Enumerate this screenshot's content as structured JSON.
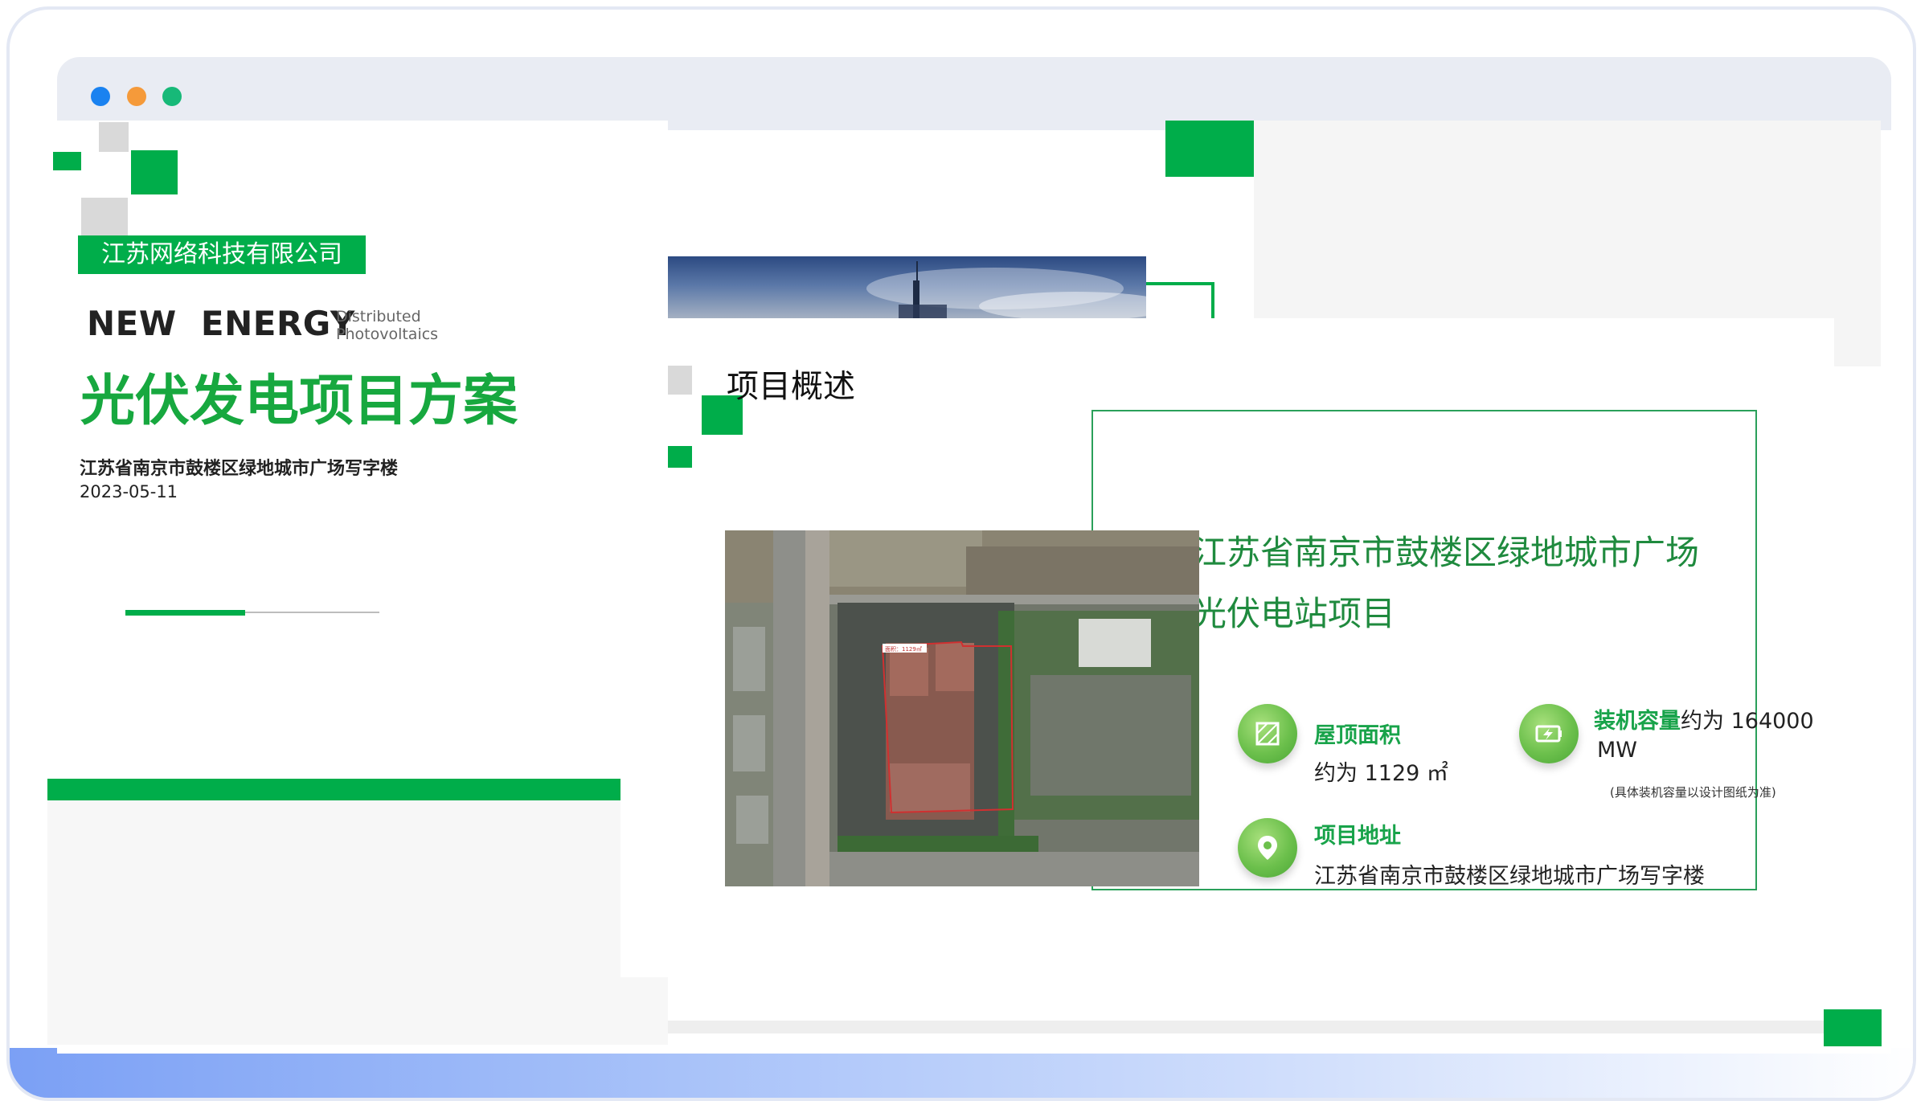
{
  "window": {
    "controls": [
      "close",
      "minimize",
      "maximize"
    ]
  },
  "slide_cover": {
    "company": "江苏网络科技有限公司",
    "tagline": "NEW  ENERGY",
    "subtitle_line1": "Distributed",
    "subtitle_line2": "Photovoltaics",
    "title": "光伏发电项目方案",
    "address": "江苏省南京市鼓楼区绿地城市广场写字楼",
    "date": "2023-05-11",
    "progress": 0.47
  },
  "slide_overview": {
    "section_title": "项目概述",
    "project_title_line1": "江苏省南京市鼓楼区绿地城市广场",
    "project_title_line2": "光伏电站项目",
    "satellite_tag": "面积：1129㎡",
    "features": {
      "roof_area": {
        "label": "屋顶面积",
        "value": "约为 1129 ㎡",
        "icon": "area-icon"
      },
      "capacity": {
        "label": "装机容量",
        "value_inline": "约为 164000",
        "value_unit": "MW",
        "note": "(具体装机容量以设计图纸为准)",
        "icon": "battery-icon"
      },
      "address": {
        "label": "项目地址",
        "value": "江苏省南京市鼓楼区绿地城市广场写字楼",
        "icon": "location-pin-icon"
      }
    }
  },
  "colors": {
    "brand_green": "#00ad4a",
    "title_green": "#17a83f",
    "titlebar": "#e9ecf3",
    "accent_grey": "#d9d9d9"
  }
}
